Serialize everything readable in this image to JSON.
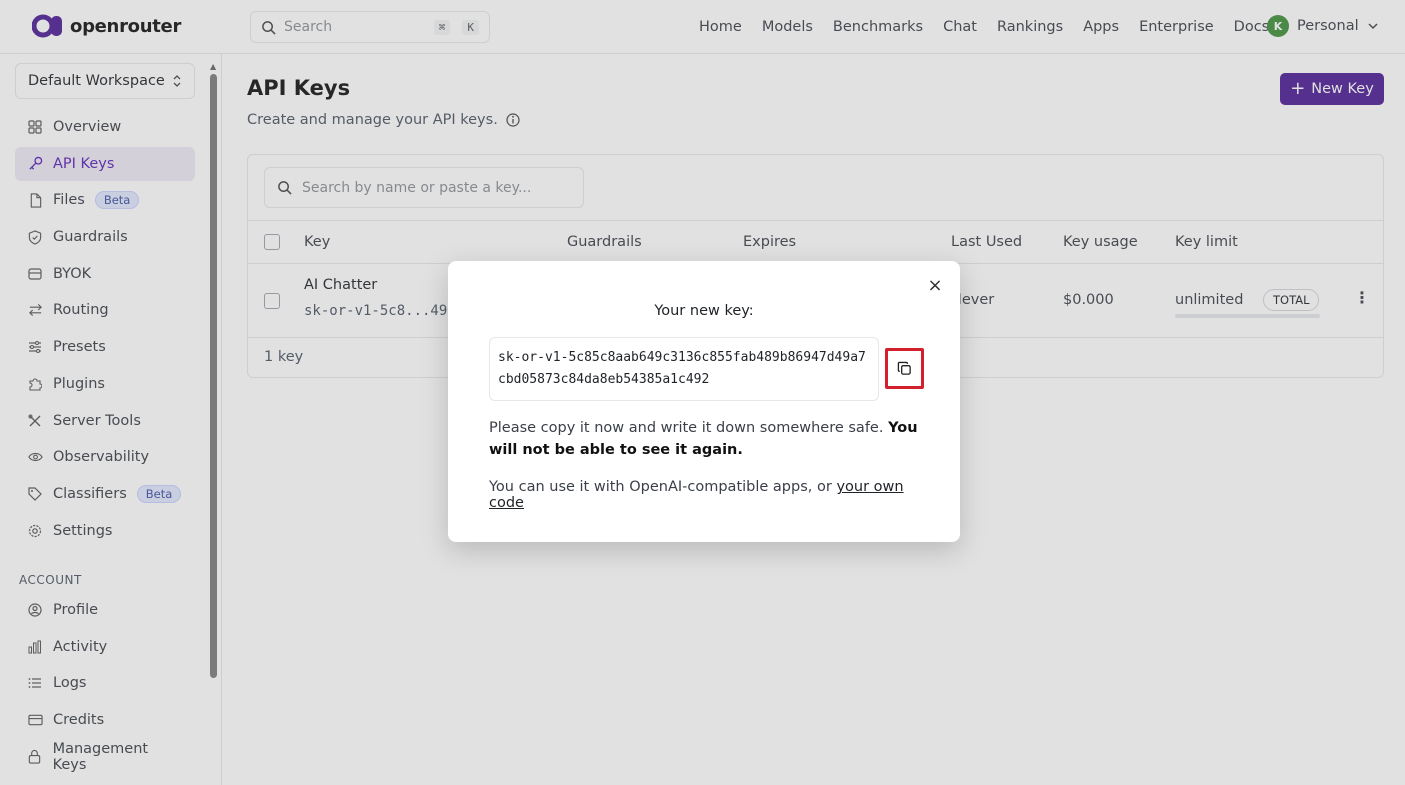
{
  "brand": {
    "name": "openrouter",
    "color": "#4c1d95"
  },
  "topbar": {
    "search_placeholder": "Search",
    "shortcut": [
      "⌘",
      "K"
    ],
    "nav": [
      "Home",
      "Models",
      "Benchmarks",
      "Chat",
      "Rankings",
      "Apps",
      "Enterprise",
      "Docs"
    ],
    "account": {
      "initial": "K",
      "label": "Personal"
    }
  },
  "sidebar": {
    "workspace": "Default Workspace",
    "items": [
      {
        "label": "Overview",
        "icon": "grid-icon"
      },
      {
        "label": "API Keys",
        "icon": "key-icon",
        "active": true
      },
      {
        "label": "Files",
        "icon": "file-icon",
        "badge": "Beta"
      },
      {
        "label": "Guardrails",
        "icon": "shield-icon"
      },
      {
        "label": "BYOK",
        "icon": "database-icon"
      },
      {
        "label": "Routing",
        "icon": "arrows-icon"
      },
      {
        "label": "Presets",
        "icon": "sliders-icon"
      },
      {
        "label": "Plugins",
        "icon": "puzzle-icon"
      },
      {
        "label": "Server Tools",
        "icon": "tools-icon"
      },
      {
        "label": "Observability",
        "icon": "eye-icon"
      },
      {
        "label": "Classifiers",
        "icon": "tag-icon",
        "badge": "Beta"
      },
      {
        "label": "Settings",
        "icon": "gear-icon"
      }
    ],
    "account_section": "ACCOUNT",
    "account_items": [
      {
        "label": "Profile",
        "icon": "user-icon"
      },
      {
        "label": "Activity",
        "icon": "chart-icon"
      },
      {
        "label": "Logs",
        "icon": "list-icon"
      },
      {
        "label": "Credits",
        "icon": "card-icon"
      },
      {
        "label": "Management Keys",
        "icon": "lock-icon"
      }
    ]
  },
  "main": {
    "title": "API Keys",
    "subtitle": "Create and manage your API keys.",
    "new_key_label": "New Key",
    "search_placeholder": "Search by name or paste a key...",
    "columns": [
      "Key",
      "Guardrails",
      "Expires",
      "Last Used",
      "Key usage",
      "Key limit"
    ],
    "rows": [
      {
        "name": "AI Chatter",
        "masked": "sk-or-v1-5c8...49",
        "last_used": "Never",
        "usage": "$0.000",
        "limit": "unlimited",
        "limit_badge": "TOTAL"
      }
    ],
    "count": "1 key"
  },
  "modal": {
    "title": "Your new key:",
    "key_value": "sk-or-v1-5c85c8aab649c3136c855fab489b86947d49a7cbd05873c84da8eb54385a1c492",
    "note_plain": "Please copy it now and write it down somewhere safe. ",
    "note_bold": "You will not be able to see it again.",
    "foot_plain": "You can use it with OpenAI-compatible apps, or ",
    "foot_link": "your own code"
  }
}
